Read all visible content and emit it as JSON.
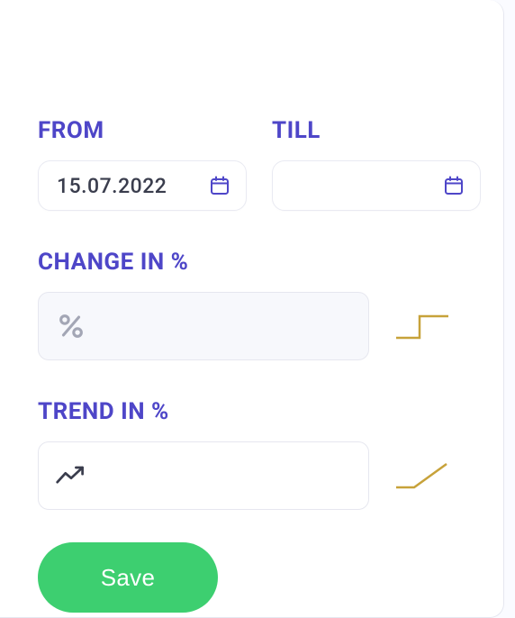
{
  "labels": {
    "from": "FROM",
    "till": "TILL",
    "change": "CHANGE IN %",
    "trend": "TREND IN %"
  },
  "fields": {
    "from_value": "15.07.2022",
    "till_value": "",
    "change_value": "",
    "trend_value": ""
  },
  "buttons": {
    "save": "Save"
  },
  "colors": {
    "accent": "#4e46c8",
    "save_bg": "#3dcf70",
    "chart_line": "#c7a23a"
  }
}
